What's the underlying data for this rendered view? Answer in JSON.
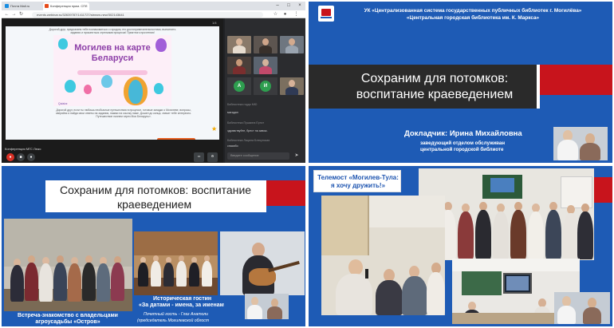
{
  "browser": {
    "tabs": [
      {
        "label": "Почта Mail.ru",
        "fav_color": "#168de2"
      },
      {
        "label": "Конференция прим. СПб",
        "fav_color": "#e64a19"
      }
    ],
    "url": "events.webinar.ru/32639787/1411727/stream-new/302143641",
    "page_counter": "1/4",
    "slide": {
      "intro_text": "Дорогой друг, предлагаем тебе познакомиться с городом, его достопримечательностями, выполнить задания и прокатиться стрелками процесса! Приятного прочтения!",
      "map_title": "Могилев на карте Беларуси",
      "quizizz": "Quizizz",
      "bottom_text": "Дорогой друг, если ты любишь необычные путешествия в процессе, готовые загадки о Могилеве, вопросы, сверяйся и найди свои ответы на задания, нажми на ссылку ниже. Дошел до конца, значит тебе интересно. Путешествие начнем через Моя Беларусь»."
    },
    "conference_label": "Конференция МГС Люкс",
    "participants": [
      {
        "initial": "А",
        "color": "#2e9e4f"
      },
      {
        "initial": "И",
        "color": "#2e9e4f"
      }
    ],
    "chat": [
      {
        "text": "Библиотека гордо МЮ",
        "dim": true
      },
      {
        "text": "магадан",
        "dim": false
      },
      {
        "text": "Библиотека Пушкина Ернст",
        "dim": true
      },
      {
        "text": "здравствуйте, брест на завож.",
        "dim": false
      },
      {
        "text": "Библиотека Лацила Блекунская",
        "dim": true
      },
      {
        "text": "спасибо",
        "dim": false
      }
    ],
    "chat_placeholder": "Введите сообщение"
  },
  "slide_intro": {
    "org_line1": "УК «Централизованная система государственных публичных библиотек г. Могилёва»",
    "org_line2": "«Центральная городская библиотека им. К. Маркса»",
    "title_line1": "Сохраним для потомков:",
    "title_line2": "воспитание краеведением",
    "speaker": "Докладчик: Ирина Михайловна",
    "position_line1": "заведующий отделом обслуживан",
    "position_line2": "центральной городской библиоте"
  },
  "slide_photos": {
    "title_line1": "Сохраним для потомков: воспитание",
    "title_line2": "краеведением",
    "caption_left_line1": "Встреча-знакомство с владельцами",
    "caption_left_line2": "агроусадьбы «Остров»",
    "caption_right_line1": "Историческая гостин",
    "caption_right_line2": "«За датами - имена, за именам",
    "guest_line1": "Почетный гость - Глаз Анатоли",
    "guest_line2": "(председатель Могилевской облост"
  },
  "slide_telemost": {
    "title_line1": "Телемост «Могилев-Тула:",
    "title_line2": "я хочу дружить!»"
  },
  "colors": {
    "slide_blue": "#1e5bb5",
    "accent_red": "#c8141c",
    "title_dark": "#2a2a2a"
  }
}
